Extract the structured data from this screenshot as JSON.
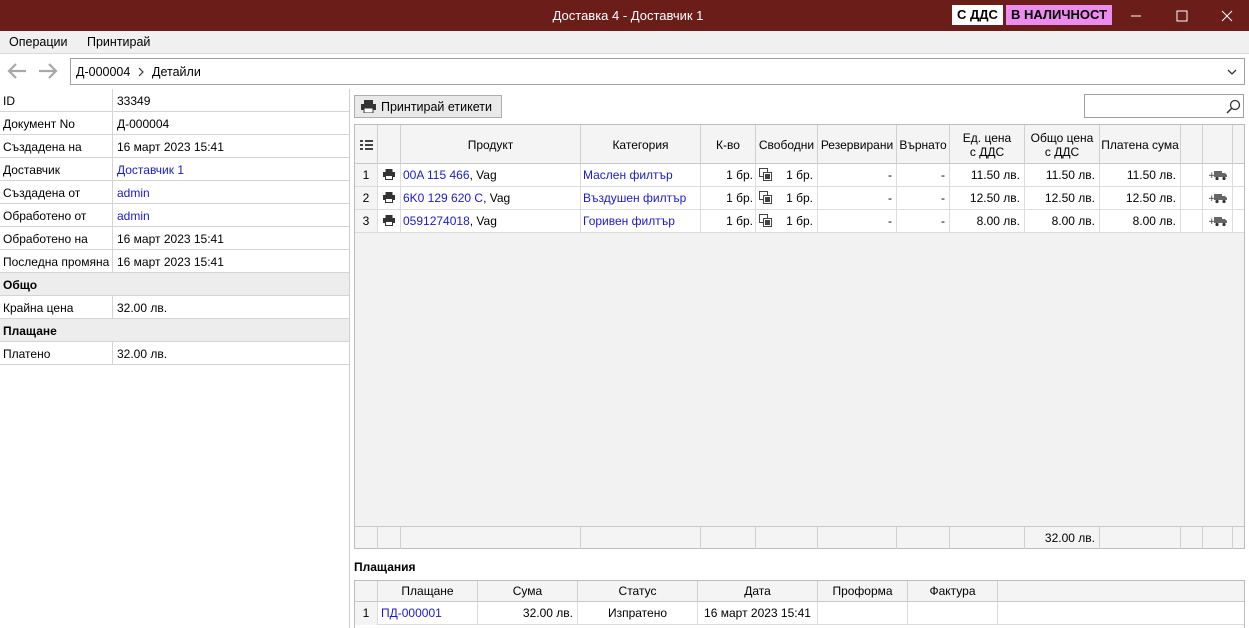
{
  "window": {
    "title": "Доставка 4 - Доставчик 1",
    "badge_vat": "С ДДС",
    "badge_stock": "В НАЛИЧНОСТ",
    "colors": {
      "titlebar": "#6b1d1a",
      "badge_stock": "#ec8cec",
      "link": "#1a1acd"
    }
  },
  "menu": {
    "operations": "Операции",
    "print": "Принтирай"
  },
  "breadcrumb": {
    "doc": "Д-000004",
    "section": "Детайли"
  },
  "details": {
    "rows": [
      {
        "label": "ID",
        "value": "33349"
      },
      {
        "label": "Документ No",
        "value": "Д-000004"
      },
      {
        "label": "Създадена на",
        "value": "16 март 2023 15:41"
      },
      {
        "label": "Доставчик",
        "value": "Доставчик 1"
      },
      {
        "label": "Създадена от",
        "value": "admin"
      },
      {
        "label": "Обработено от",
        "value": "admin"
      },
      {
        "label": "Обработено на",
        "value": "16 март 2023 15:41"
      },
      {
        "label": "Последна промяна",
        "value": "16 март 2023 15:41"
      }
    ],
    "section_total": "Общо",
    "total_row": {
      "label": "Крайна цена",
      "value": "32.00 лв."
    },
    "section_payment": "Плащане",
    "paid_row": {
      "label": "Платено",
      "value": "32.00 лв."
    }
  },
  "toolbar": {
    "print_labels": "Принтирай етикети",
    "search_placeholder": ""
  },
  "items": {
    "headers": {
      "product": "Продукт",
      "category": "Категория",
      "qty": "К-во",
      "free": "Свободни",
      "reserved": "Резервирани",
      "returned": "Върнато",
      "unit_price_1": "Ед. цена",
      "unit_price_2": "с ДДС",
      "total_price_1": "Общо цена",
      "total_price_2": "с ДДС",
      "paid": "Платена сума"
    },
    "rows": [
      {
        "n": "1",
        "code": "00A 115 466",
        "brand": ", Vag",
        "category": "Маслен филтър",
        "qty": "1 бр.",
        "free": "1 бр.",
        "reserved": "-",
        "returned": "-",
        "unit": "11.50 лв.",
        "total": "11.50 лв.",
        "paid": "11.50 лв."
      },
      {
        "n": "2",
        "code": "6K0 129 620 C",
        "brand": ", Vag",
        "category": "Въздушен филтър",
        "qty": "1 бр.",
        "free": "1 бр.",
        "reserved": "-",
        "returned": "-",
        "unit": "12.50 лв.",
        "total": "12.50 лв.",
        "paid": "12.50 лв."
      },
      {
        "n": "3",
        "code": "0591274018",
        "brand": ", Vag",
        "category": "Горивен филтър",
        "qty": "1 бр.",
        "free": "1 бр.",
        "reserved": "-",
        "returned": "-",
        "unit": "8.00 лв.",
        "total": "8.00 лв.",
        "paid": "8.00 лв."
      }
    ],
    "footer_total": "32.00 лв."
  },
  "payments": {
    "label": "Плащания",
    "headers": {
      "payment": "Плащане",
      "amount": "Сума",
      "status": "Статус",
      "date": "Дата",
      "proforma": "Проформа",
      "invoice": "Фактура"
    },
    "rows": [
      {
        "n": "1",
        "payment": "ПД-000001",
        "amount": "32.00 лв.",
        "status": "Изпратено",
        "date": "16 март 2023 15:41",
        "proforma": "",
        "invoice": ""
      }
    ]
  }
}
